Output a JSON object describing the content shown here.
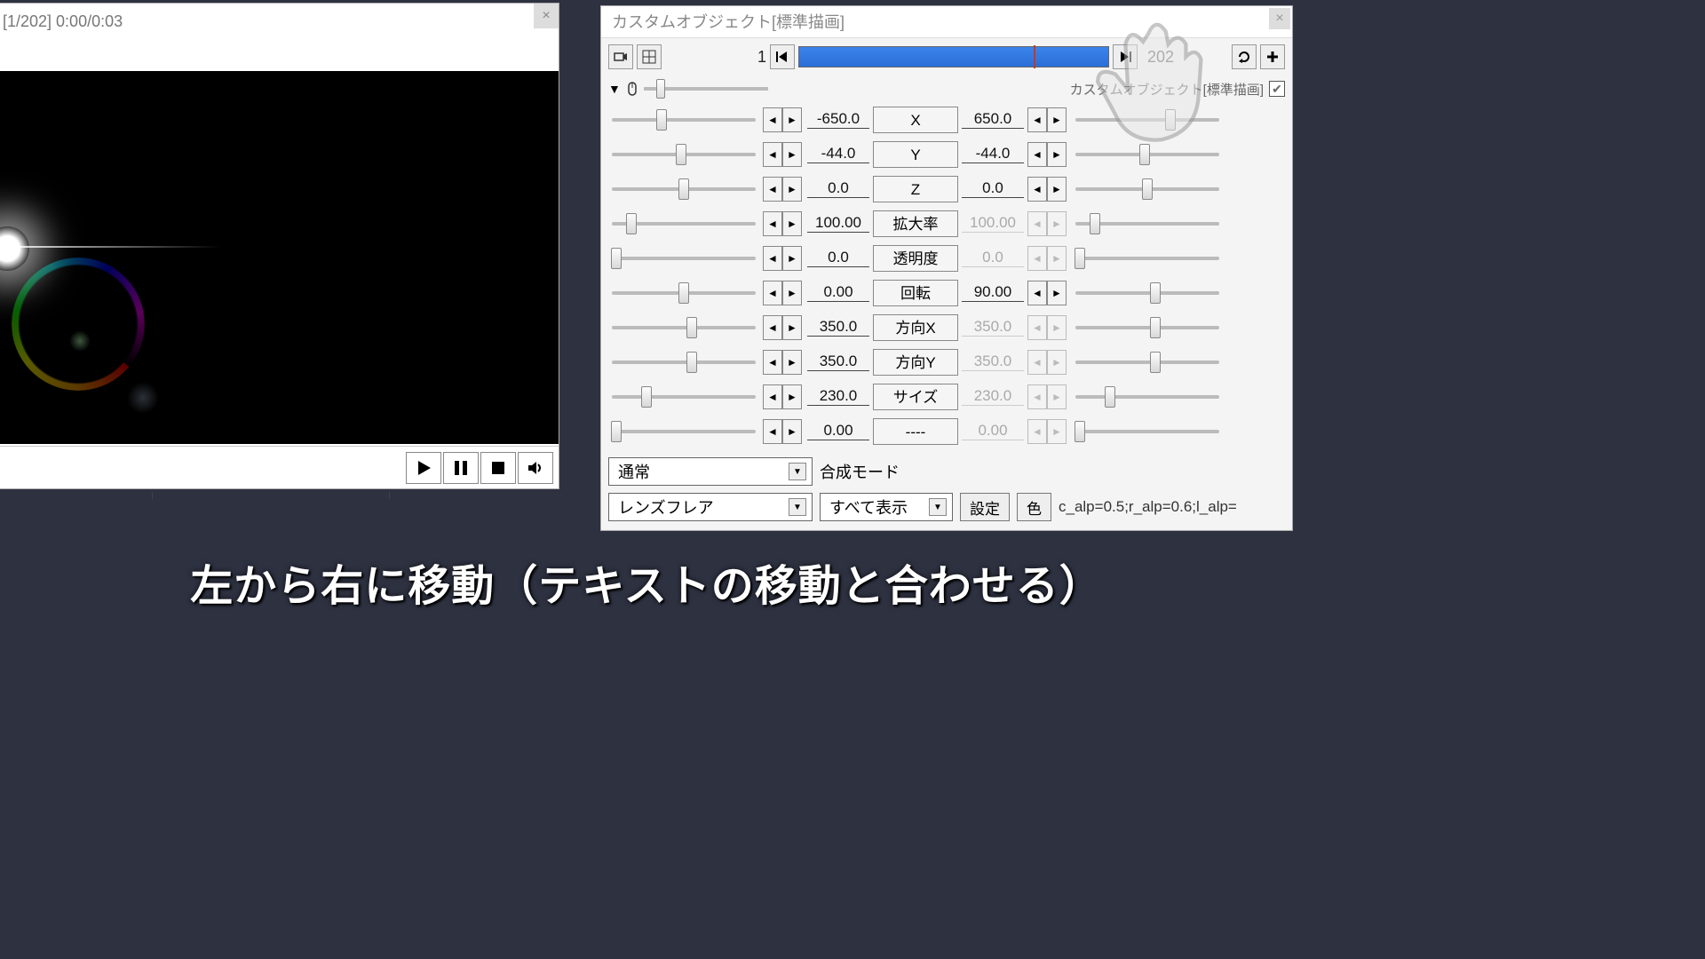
{
  "player": {
    "title": "  [1/202]  0:00/0:03"
  },
  "settings": {
    "title": "カスタムオブジェクト[標準描画]",
    "frame_start": "1",
    "frame_end": "202",
    "sub_label": "カスタムオブジェクト[標準描画]",
    "params": [
      {
        "label": "X",
        "lval": "-650.0",
        "rval": "650.0",
        "lpos": 35,
        "rpos": 65,
        "rdis": false
      },
      {
        "label": "Y",
        "lval": "-44.0",
        "rval": "-44.0",
        "lpos": 48,
        "rpos": 48,
        "rdis": false
      },
      {
        "label": "Z",
        "lval": "0.0",
        "rval": "0.0",
        "lpos": 50,
        "rpos": 50,
        "rdis": false
      },
      {
        "label": "拡大率",
        "lval": "100.00",
        "rval": "100.00",
        "lpos": 15,
        "rpos": 15,
        "rdis": true
      },
      {
        "label": "透明度",
        "lval": "0.0",
        "rval": "0.0",
        "lpos": 5,
        "rpos": 5,
        "rdis": true
      },
      {
        "label": "回転",
        "lval": "0.00",
        "rval": "90.00",
        "lpos": 50,
        "rpos": 55,
        "rdis": false
      },
      {
        "label": "方向X",
        "lval": "350.0",
        "rval": "350.0",
        "lpos": 55,
        "rpos": 55,
        "rdis": true
      },
      {
        "label": "方向Y",
        "lval": "350.0",
        "rval": "350.0",
        "lpos": 55,
        "rpos": 55,
        "rdis": true
      },
      {
        "label": "サイズ",
        "lval": "230.0",
        "rval": "230.0",
        "lpos": 25,
        "rpos": 25,
        "rdis": true
      },
      {
        "label": "----",
        "lval": "0.00",
        "rval": "0.00",
        "lpos": 5,
        "rpos": 5,
        "rdis": true
      }
    ],
    "blend_mode_label": "合成モード",
    "blend_mode_value": "通常",
    "object_type": "レンズフレア",
    "display_mode": "すべて表示",
    "settings_btn": "設定",
    "color_btn": "色",
    "args": "c_alp=0.5;r_alp=0.6;l_alp="
  },
  "caption": "左から右に移動（テキストの移動と合わせる）"
}
